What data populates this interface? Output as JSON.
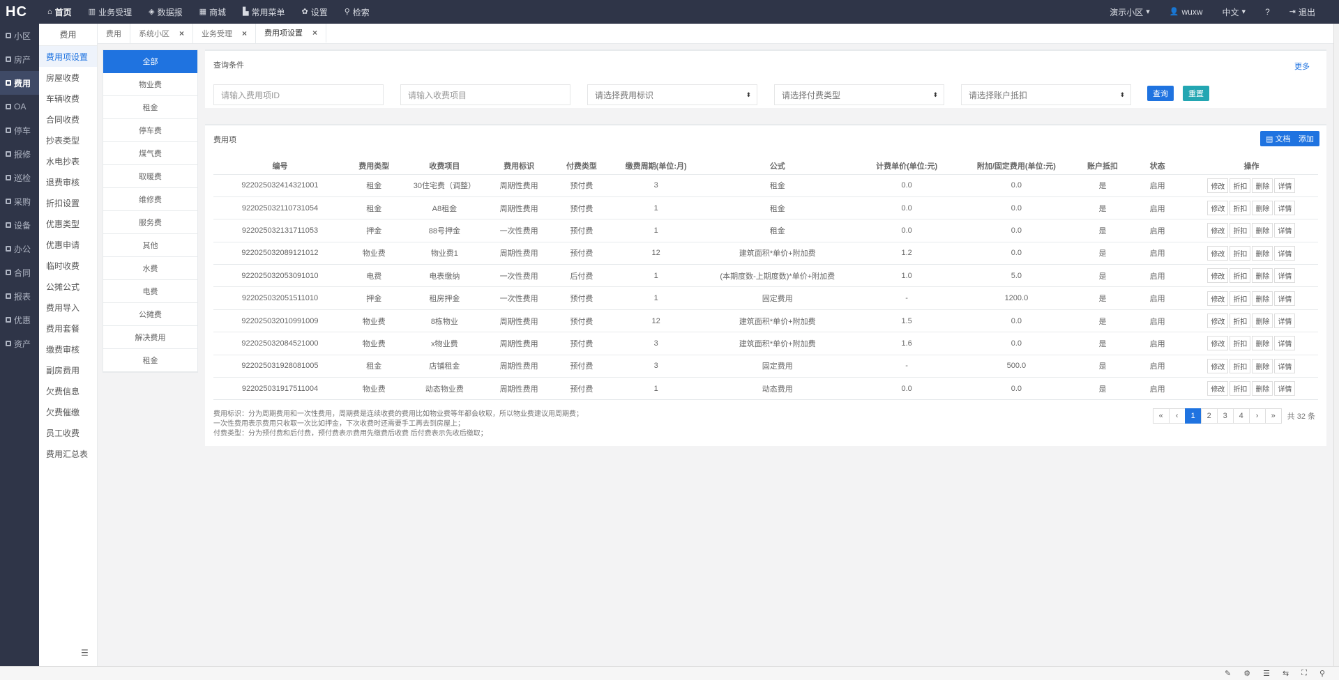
{
  "app": {
    "logo": "HC"
  },
  "topnav": [
    {
      "icon": "home-icon",
      "glyph": "⌂",
      "label": "首页",
      "active": true
    },
    {
      "icon": "chart-icon",
      "glyph": "▥",
      "label": "业务受理"
    },
    {
      "icon": "car-icon",
      "glyph": "◈",
      "label": "数据报"
    },
    {
      "icon": "shop-icon",
      "glyph": "▦",
      "label": "商城"
    },
    {
      "icon": "org-icon",
      "glyph": "▙",
      "label": "常用菜单"
    },
    {
      "icon": "gear-icon",
      "glyph": "✿",
      "label": "设置"
    },
    {
      "icon": "search-icon",
      "glyph": "⚲",
      "label": "检索"
    }
  ],
  "topright": {
    "community": "演示小区",
    "user": "wuxw",
    "lang": "中文",
    "help": "?",
    "logout": "退出"
  },
  "side1": [
    {
      "label": "小区"
    },
    {
      "label": "房产"
    },
    {
      "label": "费用",
      "active": true
    },
    {
      "label": "OA"
    },
    {
      "label": "停车"
    },
    {
      "label": "报修"
    },
    {
      "label": "巡检"
    },
    {
      "label": "采购"
    },
    {
      "label": "设备"
    },
    {
      "label": "办公"
    },
    {
      "label": "合同"
    },
    {
      "label": "报表"
    },
    {
      "label": "优惠"
    },
    {
      "label": "资产"
    }
  ],
  "side2": {
    "title": "费用",
    "items": [
      {
        "label": "费用项设置",
        "active": true
      },
      {
        "label": "房屋收费"
      },
      {
        "label": "车辆收费"
      },
      {
        "label": "合同收费"
      },
      {
        "label": "抄表类型"
      },
      {
        "label": "水电抄表"
      },
      {
        "label": "退费审核"
      },
      {
        "label": "折扣设置"
      },
      {
        "label": "优惠类型"
      },
      {
        "label": "优惠申请"
      },
      {
        "label": "临时收费"
      },
      {
        "label": "公摊公式"
      },
      {
        "label": "费用导入"
      },
      {
        "label": "费用套餐"
      },
      {
        "label": "缴费审核"
      },
      {
        "label": "副房费用"
      },
      {
        "label": "欠费信息"
      },
      {
        "label": "欠费催缴"
      },
      {
        "label": "员工收费"
      },
      {
        "label": "费用汇总表"
      }
    ]
  },
  "tabs": [
    {
      "label": "费用"
    },
    {
      "label": "系统小区"
    },
    {
      "label": "业务受理"
    },
    {
      "label": "费用项设置",
      "active": true
    }
  ],
  "categories": [
    {
      "label": "全部",
      "active": true
    },
    {
      "label": "物业费"
    },
    {
      "label": "租金"
    },
    {
      "label": "停车费"
    },
    {
      "label": "煤气费"
    },
    {
      "label": "取暖费"
    },
    {
      "label": "维修费"
    },
    {
      "label": "服务费"
    },
    {
      "label": "其他"
    },
    {
      "label": "水费"
    },
    {
      "label": "电费"
    },
    {
      "label": "公摊费"
    },
    {
      "label": "解决费用"
    },
    {
      "label": "租金"
    }
  ],
  "query": {
    "title": "查询条件",
    "more": "更多",
    "fee_id_placeholder": "请输入费用项ID",
    "item_placeholder": "请输入收费项目",
    "flag_select": "请选择费用标识",
    "pay_type_select": "请选择付费类型",
    "deduct_select": "请选择账户抵扣",
    "search_btn": "查询",
    "reset_btn": "重置"
  },
  "feelist": {
    "title": "费用项",
    "doc_btn": "文档",
    "add_btn": "添加",
    "columns": [
      "编号",
      "费用类型",
      "收费项目",
      "费用标识",
      "付费类型",
      "缴费周期(单位:月)",
      "公式",
      "计费单价(单位:元)",
      "附加/固定费用(单位:元)",
      "账户抵扣",
      "状态",
      "操作"
    ],
    "actions": [
      "修改",
      "折扣",
      "删除",
      "详情"
    ],
    "rows": [
      [
        "922025032414321001",
        "租金",
        "30住宅费（调整）",
        "周期性费用",
        "预付费",
        "3",
        "租金",
        "0.0",
        "0.0",
        "是",
        "启用"
      ],
      [
        "922025032110731054",
        "租金",
        "A8租金",
        "周期性费用",
        "预付费",
        "1",
        "租金",
        "0.0",
        "0.0",
        "是",
        "启用"
      ],
      [
        "922025032131711053",
        "押金",
        "88号押金",
        "一次性费用",
        "预付费",
        "1",
        "租金",
        "0.0",
        "0.0",
        "是",
        "启用"
      ],
      [
        "922025032089121012",
        "物业费",
        "物业费1",
        "周期性费用",
        "预付费",
        "12",
        "建筑面积*单价+附加费",
        "1.2",
        "0.0",
        "是",
        "启用"
      ],
      [
        "922025032053091010",
        "电费",
        "电表缴纳",
        "一次性费用",
        "后付费",
        "1",
        "(本期度数-上期度数)*单价+附加费",
        "1.0",
        "5.0",
        "是",
        "启用"
      ],
      [
        "922025032051511010",
        "押金",
        "租房押金",
        "一次性费用",
        "预付费",
        "1",
        "固定费用",
        "-",
        "1200.0",
        "是",
        "启用"
      ],
      [
        "922025032010991009",
        "物业费",
        "8栋物业",
        "周期性费用",
        "预付费",
        "12",
        "建筑面积*单价+附加费",
        "1.5",
        "0.0",
        "是",
        "启用"
      ],
      [
        "922025032084521000",
        "物业费",
        "x物业费",
        "周期性费用",
        "预付费",
        "3",
        "建筑面积*单价+附加费",
        "1.6",
        "0.0",
        "是",
        "启用"
      ],
      [
        "922025031928081005",
        "租金",
        "店铺租金",
        "周期性费用",
        "预付费",
        "3",
        "固定费用",
        "-",
        "500.0",
        "是",
        "启用"
      ],
      [
        "922025031917511004",
        "物业费",
        "动态物业费",
        "周期性费用",
        "预付费",
        "1",
        "动态费用",
        "0.0",
        "0.0",
        "是",
        "启用"
      ]
    ],
    "notes": [
      "费用标识：分为周期费用和一次性费用，周期费是连续收费的费用比如物业费等年都会收取，所以物业费建议用周期费；",
      "一次性费用表示费用只收取一次比如押金，下次收费时还需要手工再去到房屋上；",
      "付费类型：分为预付费和后付费，预付费表示费用先缴费后收费 后付费表示先收后缴取；"
    ],
    "pager": {
      "pages": [
        "«",
        "‹",
        "1",
        "2",
        "3",
        "4",
        "›",
        "»"
      ],
      "active": "1",
      "total": "共 32 条"
    }
  },
  "statusbar": [
    "✎",
    "⚙",
    "☰",
    "⇆",
    "⛶",
    "⚲"
  ]
}
